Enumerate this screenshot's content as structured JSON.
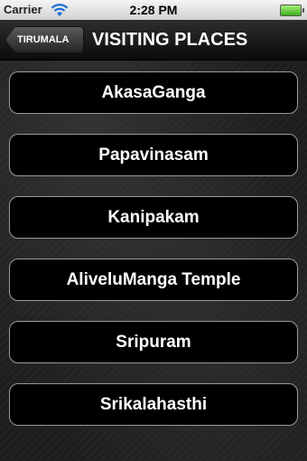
{
  "status_bar": {
    "carrier": "Carrier",
    "time": "2:28 PM",
    "battery_color": "#3cae1e"
  },
  "nav": {
    "back_label": "TIRUMALA",
    "title": "VISITING PLACES"
  },
  "places": [
    {
      "label": "AkasaGanga"
    },
    {
      "label": "Papavinasam"
    },
    {
      "label": "Kanipakam"
    },
    {
      "label": "AliveluManga Temple"
    },
    {
      "label": "Sripuram"
    },
    {
      "label": "Srikalahasthi"
    }
  ]
}
